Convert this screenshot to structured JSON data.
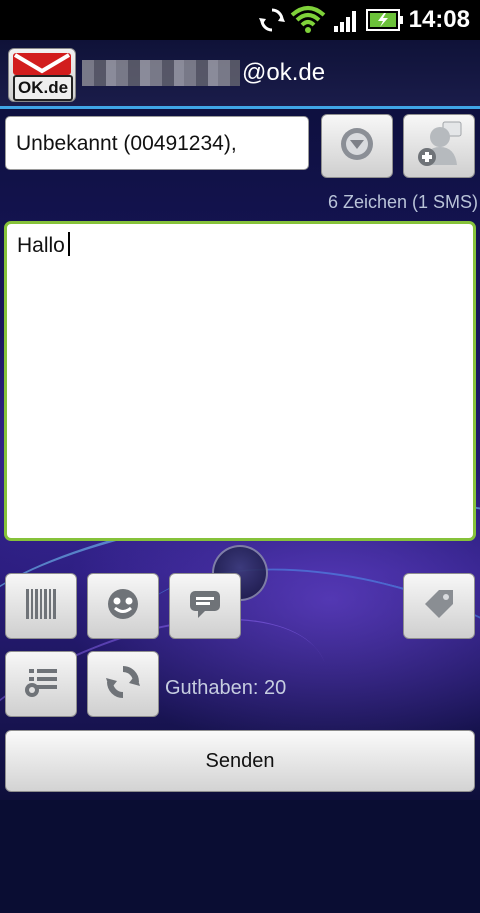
{
  "status_bar": {
    "time": "14:08",
    "icons": [
      "sync-icon",
      "wifi-icon",
      "signal-icon",
      "battery-charging-icon"
    ]
  },
  "header": {
    "logo_text": "OK.de",
    "account_suffix": "@ok.de"
  },
  "recipient": {
    "value": "Unbekannt (00491234),",
    "dropdown_icon": "chevron-down-circle-icon",
    "add_contact_icon": "add-contact-icon"
  },
  "counter": {
    "text": "6 Zeichen (1 SMS)"
  },
  "message": {
    "value": "Hallo"
  },
  "toolbar": {
    "buttons": [
      {
        "icon": "barcode-icon"
      },
      {
        "icon": "smiley-icon"
      },
      {
        "icon": "message-bubble-icon"
      },
      {
        "icon": "tag-icon"
      },
      {
        "icon": "list-settings-icon"
      },
      {
        "icon": "refresh-icon"
      }
    ]
  },
  "balance": {
    "text": "Guthaben: 20"
  },
  "actions": {
    "send_label": "Senden"
  },
  "colors": {
    "accent_blue": "#3fa5e6",
    "focus_green": "#86c23a",
    "brand_red": "#d21d1d"
  }
}
